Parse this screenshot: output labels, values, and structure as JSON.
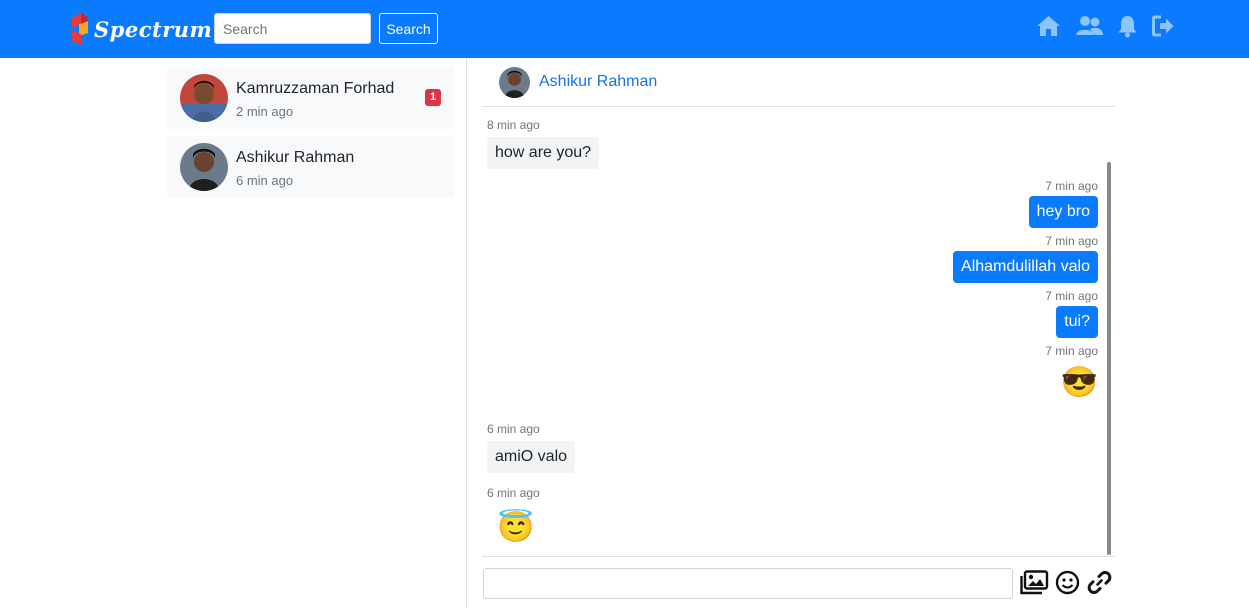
{
  "app": {
    "brand": "Spectrum"
  },
  "search": {
    "placeholder": "Search",
    "button_label": "Search"
  },
  "nav_icons": [
    "home-icon",
    "users-icon",
    "bell-icon",
    "logout-icon"
  ],
  "colors": {
    "primary": "#0a7bff",
    "badge": "#dc3545",
    "incoming_bubble": "#f1f3f4",
    "link": "#1a73e8"
  },
  "conversations": [
    {
      "name": "Kamruzzaman Forhad",
      "time": "2 min ago",
      "unread": "1"
    },
    {
      "name": "Ashikur Rahman",
      "time": "6 min ago"
    }
  ],
  "chat": {
    "contact_name": "Ashikur Rahman",
    "messages": [
      {
        "direction": "in",
        "time": "8 min ago",
        "text": "how are you?"
      },
      {
        "direction": "out",
        "time": "7 min ago",
        "text": "hey bro"
      },
      {
        "direction": "out",
        "time": "7 min ago",
        "text": "Alhamdulillah valo"
      },
      {
        "direction": "out",
        "time": "7 min ago",
        "text": "tui?"
      },
      {
        "direction": "out",
        "time": "7 min ago",
        "emoji": "😎"
      },
      {
        "direction": "in",
        "time": "6 min ago",
        "text": "amiO valo"
      },
      {
        "direction": "in",
        "time": "6 min ago",
        "emoji": "😇"
      }
    ]
  },
  "composer": {
    "value": "",
    "tools": [
      "image-icon",
      "smile-icon",
      "link-icon"
    ]
  }
}
